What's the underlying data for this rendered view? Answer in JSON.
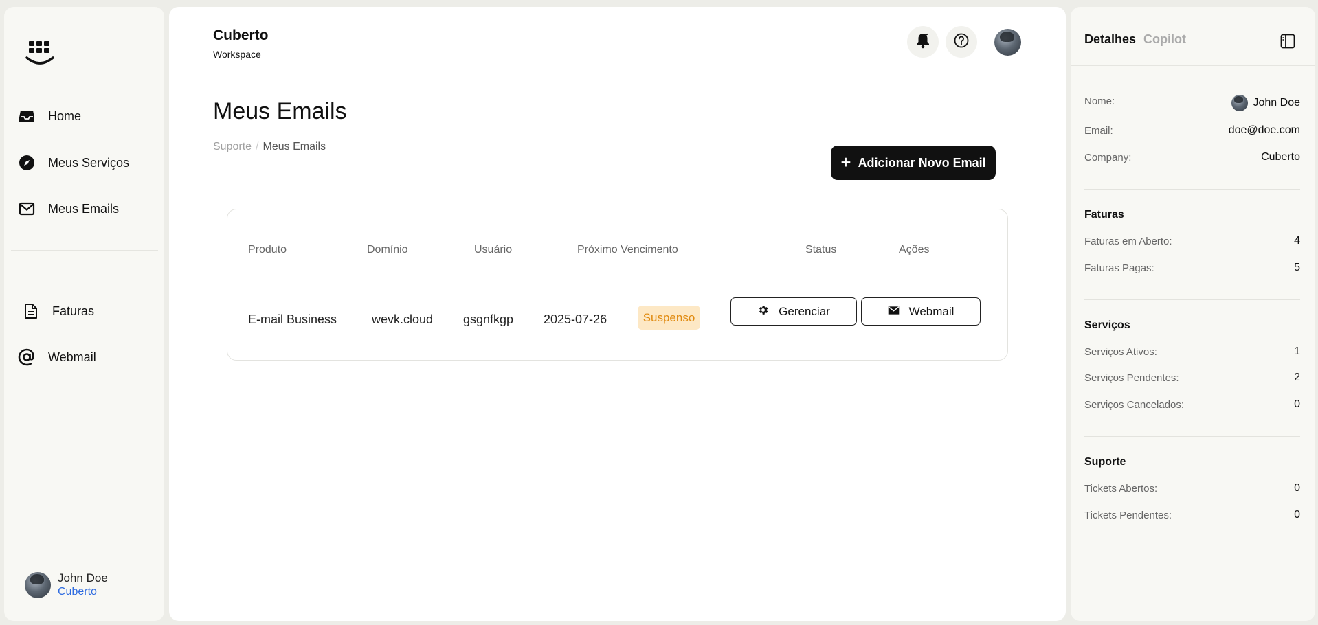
{
  "workspace": {
    "title": "Cuberto",
    "subtitle": "Workspace"
  },
  "sidebar": {
    "items": [
      {
        "label": "Home",
        "icon": "inbox-icon"
      },
      {
        "label": "Meus Serviços",
        "icon": "compass-icon"
      },
      {
        "label": "Meus Emails",
        "icon": "mail-icon"
      },
      {
        "label": "Faturas",
        "icon": "document-icon"
      },
      {
        "label": "Webmail",
        "icon": "at-icon"
      }
    ],
    "user": {
      "name": "John Doe",
      "company": "Cuberto"
    }
  },
  "main": {
    "page_title": "Meus Emails",
    "breadcrumb": {
      "parent": "Suporte",
      "separator": "/",
      "current": "Meus Emails"
    },
    "add_button_label": "Adicionar Novo Email",
    "table": {
      "headers": [
        "Produto",
        "Domínio",
        "Usuário",
        "Próximo Vencimento",
        "Status",
        "Ações"
      ],
      "rows": [
        {
          "produto": "E-mail Business",
          "dominio": "wevk.cloud",
          "usuario": "gsgnfkgp",
          "vencimento": "2025-07-26",
          "status": "Suspenso",
          "actions": [
            "Gerenciar",
            "Webmail"
          ]
        }
      ]
    }
  },
  "details": {
    "tabs": [
      "Detalhes",
      "Copilot"
    ],
    "profile": [
      {
        "label": "Nome:",
        "value": "John Doe"
      },
      {
        "label": "Email:",
        "value": "doe@doe.com"
      },
      {
        "label": "Company:",
        "value": "Cuberto"
      }
    ],
    "faturas": {
      "title": "Faturas",
      "rows": [
        {
          "label": "Faturas em Aberto:",
          "value": "4"
        },
        {
          "label": "Faturas Pagas:",
          "value": "5"
        }
      ]
    },
    "servicos": {
      "title": "Serviços",
      "rows": [
        {
          "label": "Serviços Ativos:",
          "value": "1"
        },
        {
          "label": "Serviços Pendentes:",
          "value": "2"
        },
        {
          "label": "Serviços Cancelados:",
          "value": "0"
        }
      ]
    },
    "suporte": {
      "title": "Suporte",
      "rows": [
        {
          "label": "Tickets Abertos:",
          "value": "0"
        },
        {
          "label": "Tickets Pendentes:",
          "value": "0"
        }
      ]
    }
  },
  "colors": {
    "accent": "#111111",
    "status_suspended_bg": "#fde8c5",
    "status_suspended_text": "#e08a10",
    "link": "#2e6be0"
  }
}
